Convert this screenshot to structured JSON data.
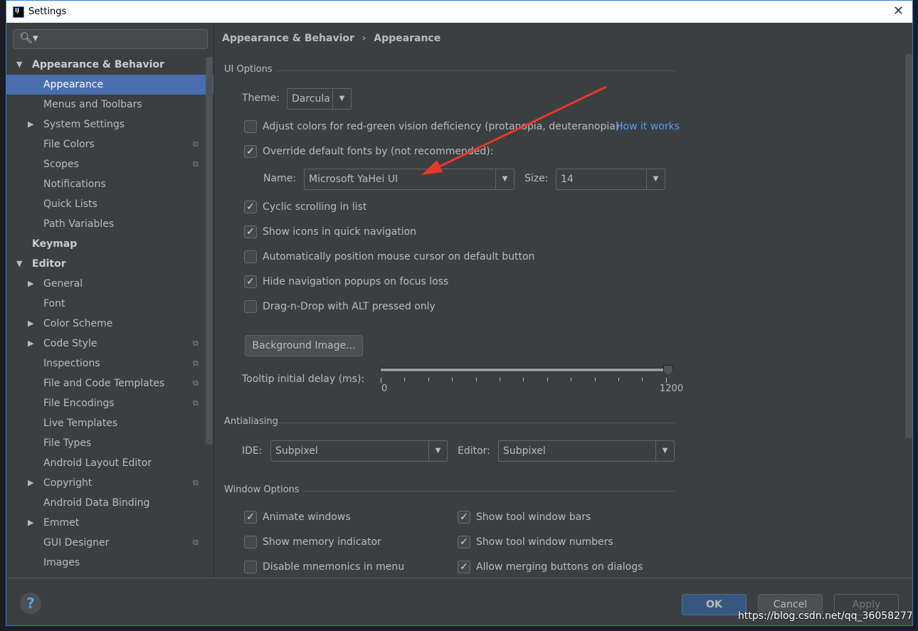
{
  "window": {
    "title": "Settings",
    "logo": "IJ"
  },
  "sidebar": {
    "items": [
      {
        "label": "Appearance & Behavior",
        "level": 0,
        "expander": "down",
        "bold": true
      },
      {
        "label": "Appearance",
        "level": 1,
        "selected": true
      },
      {
        "label": "Menus and Toolbars",
        "level": 1
      },
      {
        "label": "System Settings",
        "level": 1,
        "expander": "right"
      },
      {
        "label": "File Colors",
        "level": 1,
        "copy": true
      },
      {
        "label": "Scopes",
        "level": 1,
        "copy": true
      },
      {
        "label": "Notifications",
        "level": 1
      },
      {
        "label": "Quick Lists",
        "level": 1
      },
      {
        "label": "Path Variables",
        "level": 1
      },
      {
        "label": "Keymap",
        "level": 0,
        "bold": true
      },
      {
        "label": "Editor",
        "level": 0,
        "expander": "down",
        "bold": true
      },
      {
        "label": "General",
        "level": 1,
        "expander": "right"
      },
      {
        "label": "Font",
        "level": 1
      },
      {
        "label": "Color Scheme",
        "level": 1,
        "expander": "right"
      },
      {
        "label": "Code Style",
        "level": 1,
        "expander": "right",
        "copy": true
      },
      {
        "label": "Inspections",
        "level": 1,
        "copy": true
      },
      {
        "label": "File and Code Templates",
        "level": 1,
        "copy": true
      },
      {
        "label": "File Encodings",
        "level": 1,
        "copy": true
      },
      {
        "label": "Live Templates",
        "level": 1
      },
      {
        "label": "File Types",
        "level": 1
      },
      {
        "label": "Android Layout Editor",
        "level": 1
      },
      {
        "label": "Copyright",
        "level": 1,
        "expander": "right",
        "copy": true
      },
      {
        "label": "Android Data Binding",
        "level": 1
      },
      {
        "label": "Emmet",
        "level": 1,
        "expander": "right"
      },
      {
        "label": "GUI Designer",
        "level": 1,
        "copy": true
      },
      {
        "label": "Images",
        "level": 1
      }
    ]
  },
  "breadcrumb": {
    "parent": "Appearance & Behavior",
    "sep": "›",
    "current": "Appearance"
  },
  "ui_options": {
    "title": "UI Options",
    "theme_label": "Theme:",
    "theme": "Darcula",
    "protanopia": {
      "label": "Adjust colors for red-green vision deficiency (protanopia, deuteranopia)",
      "checked": false,
      "link": "How it works"
    },
    "override_fonts": {
      "label": "Override default fonts by (not recommended):",
      "checked": true
    },
    "name_label": "Name:",
    "font_name": "Microsoft YaHei UI",
    "size_label": "Size:",
    "font_size": "14",
    "checks": [
      {
        "label": "Cyclic scrolling in list",
        "checked": true
      },
      {
        "label": "Show icons in quick navigation",
        "checked": true
      },
      {
        "label": "Automatically position mouse cursor on default button",
        "checked": false
      },
      {
        "label": "Hide navigation popups on focus loss",
        "checked": true
      },
      {
        "label": "Drag-n-Drop with ALT pressed only",
        "checked": false
      }
    ],
    "background_button": "Background Image...",
    "tooltip_label": "Tooltip initial delay (ms):",
    "tooltip_min": "0",
    "tooltip_max": "1200",
    "tooltip_value": 1200
  },
  "antialiasing": {
    "title": "Antialiasing",
    "ide_label": "IDE:",
    "ide": "Subpixel",
    "editor_label": "Editor:",
    "editor": "Subpixel"
  },
  "window_options": {
    "title": "Window Options",
    "left": [
      {
        "label": "Animate windows",
        "checked": true
      },
      {
        "label": "Show memory indicator",
        "checked": false
      },
      {
        "label": "Disable mnemonics in menu",
        "checked": false
      }
    ],
    "right": [
      {
        "label": "Show tool window bars",
        "checked": true
      },
      {
        "label": "Show tool window numbers",
        "checked": true
      },
      {
        "label": "Allow merging buttons on dialogs",
        "checked": true
      }
    ]
  },
  "footer": {
    "ok": "OK",
    "cancel": "Cancel",
    "apply": "Apply"
  },
  "watermark": "https://blog.csdn.net/qq_36058277",
  "colors": {
    "selection": "#4b6eaf",
    "background": "#3c3f41",
    "link": "#589df6",
    "annotation_arrow": "#e8382c",
    "ok_button": "#365880"
  }
}
